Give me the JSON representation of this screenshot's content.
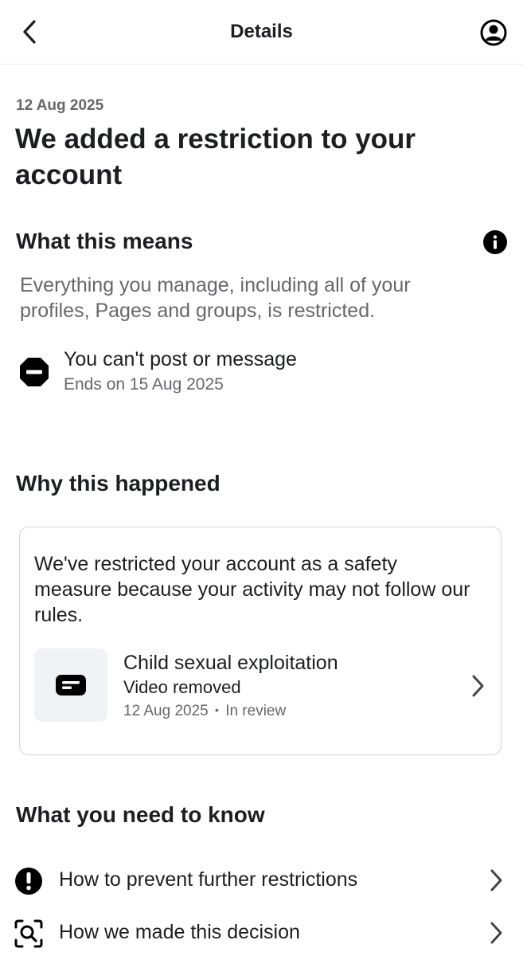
{
  "header": {
    "title": "Details"
  },
  "notice": {
    "date": "12 Aug 2025",
    "title": "We added a restriction to your account"
  },
  "meaning": {
    "heading": "What this means",
    "description": "Everything you manage, including all of your profiles, Pages and groups, is restricted.",
    "restriction": {
      "title": "You can't post or message",
      "ends": "Ends on 15 Aug 2025"
    }
  },
  "why": {
    "heading": "Why this happened",
    "text": "We've restricted your account as a safety measure because your activity may not follow our rules.",
    "violation": {
      "title": "Child sexual exploitation",
      "subtitle": "Video removed",
      "date": "12 Aug 2025",
      "separator": "•",
      "status": "In review"
    }
  },
  "know": {
    "heading": "What you need to know",
    "items": [
      {
        "label": "How to prevent further restrictions",
        "icon": "exclamation-circle-icon"
      },
      {
        "label": "How we made this decision",
        "icon": "search-scan-icon"
      }
    ]
  }
}
